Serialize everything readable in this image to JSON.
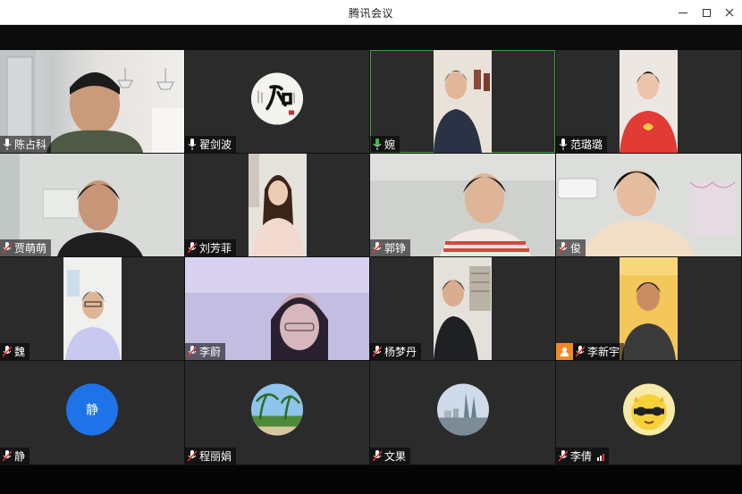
{
  "window": {
    "title": "腾讯会议",
    "controls": [
      "minimize-icon",
      "maximize-icon",
      "close-icon"
    ]
  },
  "colors": {
    "titlebar": "#ffffff",
    "stage": "#000000",
    "tile": "#2b2b2b",
    "active_speaker": "#3aa53a",
    "avatar_blue": "#1e73e8",
    "badge_orange": "#f08a24"
  },
  "participants": [
    {
      "name": "陈占科",
      "mic": "mic-on-icon"
    },
    {
      "name": "翟剑波",
      "mic": "mic-on-icon"
    },
    {
      "name": "婉",
      "mic": "mic-active-icon"
    },
    {
      "name": "范璐璐",
      "mic": "mic-on-icon"
    },
    {
      "name": "贾萌萌",
      "mic": "mic-muted-icon"
    },
    {
      "name": "刘芳菲",
      "mic": "mic-muted-icon"
    },
    {
      "name": "郭铮",
      "mic": "mic-muted-icon"
    },
    {
      "name": "俊",
      "mic": "mic-muted-icon"
    },
    {
      "name": "魏",
      "mic": "mic-muted-icon"
    },
    {
      "name": "李蔚",
      "mic": "mic-muted-icon"
    },
    {
      "name": "杨梦丹",
      "mic": "mic-muted-icon"
    },
    {
      "name": "李新宇",
      "mic": "mic-muted-icon"
    },
    {
      "name": "静",
      "mic": "mic-muted-icon",
      "avatar_text": "静"
    },
    {
      "name": "程丽娟",
      "mic": "mic-muted-icon"
    },
    {
      "name": "文果",
      "mic": "mic-muted-icon"
    },
    {
      "name": "李倩",
      "mic": "mic-muted-icon"
    }
  ]
}
